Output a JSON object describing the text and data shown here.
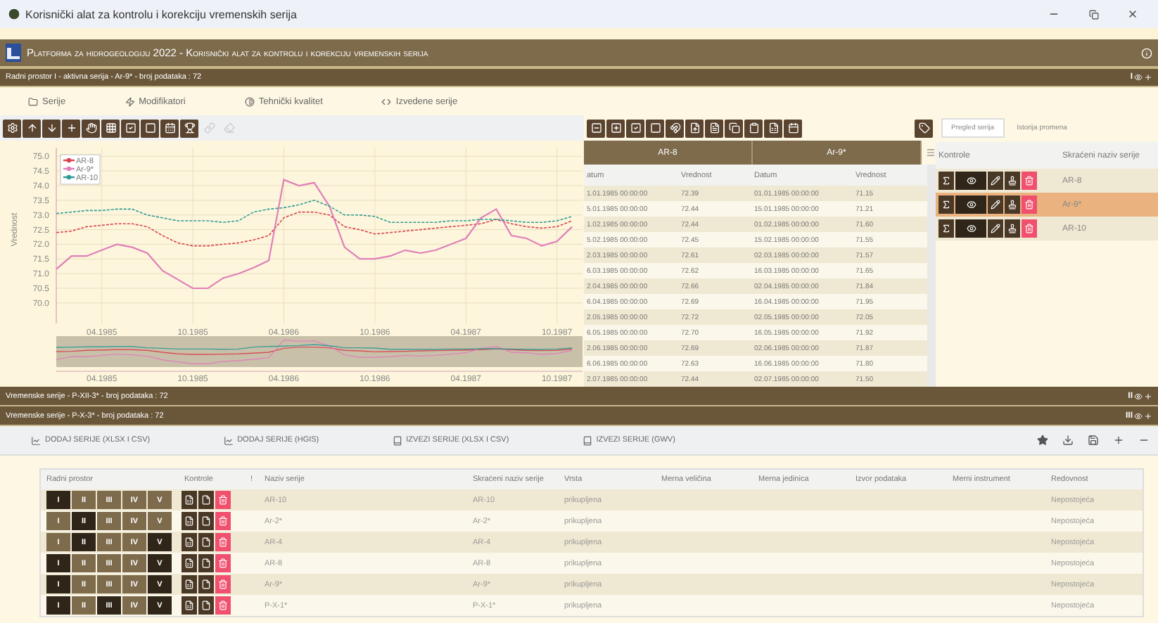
{
  "window": {
    "title": "Korisnički alat za kontrolu i korekciju vremenskih serija"
  },
  "header": {
    "title": "Platforma za hidrogeologiju 2022 - Korisnički alat za kontrolu i korekciju vremenskih serija"
  },
  "workspace_bar": {
    "text": "Radni prostor I - aktivna serija - Ar-9* - broj podataka : 72",
    "badge": "I"
  },
  "tabs": [
    {
      "label": "Serije"
    },
    {
      "label": "Modifikatori"
    },
    {
      "label": "Tehnički kvalitet"
    },
    {
      "label": "Izvedene serije"
    }
  ],
  "chart_toolbar": [
    {
      "disabled": false
    },
    {
      "disabled": false
    },
    {
      "disabled": false
    },
    {
      "disabled": false
    },
    {
      "disabled": false
    },
    {
      "disabled": false
    },
    {
      "disabled": false
    },
    {
      "disabled": false
    },
    {
      "disabled": false
    },
    {
      "disabled": false
    },
    {
      "disabled": true
    },
    {
      "disabled": true
    }
  ],
  "chart": {
    "chart_data": {
      "type": "line",
      "ylabel": "Vrednost",
      "categories": [
        null,
        null,
        null,
        "04.1985",
        null,
        null,
        null,
        null,
        null,
        "10.1985",
        null,
        null,
        null,
        null,
        null,
        "04.1986",
        null,
        null,
        null,
        null,
        null,
        "10.1986",
        null,
        null,
        null,
        null,
        null,
        "04.1987",
        null,
        null,
        null,
        null,
        null,
        "10.1987",
        null
      ],
      "grid": true,
      "legend": true,
      "ylim": [
        69.3,
        75.2
      ],
      "yticks": [
        {
          "value": 70,
          "label": "70.0"
        },
        {
          "value": 70.5,
          "label": "70.5"
        },
        {
          "value": 71,
          "label": "71.0"
        },
        {
          "value": 71.5,
          "label": "71.5"
        },
        {
          "value": 72,
          "label": "72.0"
        },
        {
          "value": 72.5,
          "label": "72.5"
        },
        {
          "value": 73,
          "label": "73.0"
        },
        {
          "value": 73.5,
          "label": "73.5"
        },
        {
          "value": 74,
          "label": "74.0"
        },
        {
          "value": 74.5,
          "label": "74.5"
        },
        {
          "value": 75,
          "label": "75.0"
        }
      ],
      "series": [
        {
          "name": "AR-8",
          "color": "#d9434e",
          "line_style": "dashed",
          "values": [
            72.4,
            72.45,
            72.6,
            72.65,
            72.7,
            72.7,
            72.6,
            72.3,
            72.05,
            71.95,
            71.95,
            72.0,
            72.05,
            72.15,
            72.3,
            72.9,
            73.1,
            73.1,
            73.0,
            72.6,
            72.5,
            72.35,
            72.4,
            72.45,
            72.5,
            72.55,
            72.6,
            72.65,
            72.7,
            72.85,
            72.7,
            72.6,
            72.55,
            72.6,
            72.8
          ]
        },
        {
          "name": "Ar-9*",
          "color": "#e07fb8",
          "line_style": "solid",
          "values": [
            71.15,
            71.6,
            71.6,
            71.8,
            72.0,
            71.9,
            71.7,
            71.1,
            70.8,
            70.5,
            70.5,
            70.85,
            71.0,
            71.2,
            71.45,
            74.2,
            74.0,
            74.1,
            73.3,
            71.9,
            71.5,
            71.5,
            71.6,
            71.8,
            71.7,
            71.8,
            72.0,
            72.2,
            72.9,
            73.2,
            72.3,
            72.2,
            71.95,
            72.1,
            72.6
          ]
        },
        {
          "name": "AR-10",
          "color": "#2f9a94",
          "line_style": "dashed",
          "values": [
            73.05,
            73.1,
            73.15,
            73.15,
            73.2,
            73.2,
            73.0,
            72.9,
            72.8,
            72.8,
            72.8,
            72.75,
            72.8,
            73.1,
            73.2,
            73.25,
            73.35,
            73.5,
            73.3,
            73.0,
            73.0,
            72.95,
            72.75,
            72.75,
            72.75,
            72.75,
            72.8,
            72.8,
            72.85,
            72.85,
            72.8,
            72.75,
            72.75,
            72.8,
            72.95
          ]
        }
      ]
    },
    "navigator_labels": [
      "04.1985",
      "10.1985",
      "04.1986",
      "10.1986",
      "04.1987",
      "10.1987"
    ]
  },
  "data_table": {
    "groups": [
      "AR-8",
      "Ar-9*"
    ],
    "columns": [
      "atum",
      "Vrednost",
      "Datum",
      "Vrednost"
    ],
    "rows": [
      [
        "1.01.1985 00:00:00",
        "72.39",
        "01.01.1985 00:00:00",
        "71.15"
      ],
      [
        "5.01.1985 00:00:00",
        "72.44",
        "15.01.1985 00:00:00",
        "71.21"
      ],
      [
        "1.02.1985 00:00:00",
        "72.44",
        "01.02.1985 00:00:00",
        "71.60"
      ],
      [
        "5.02.1985 00:00:00",
        "72.45",
        "15.02.1985 00:00:00",
        "71.55"
      ],
      [
        "2.03.1985 00:00:00",
        "72.61",
        "02.03.1985 00:00:00",
        "71.57"
      ],
      [
        "6.03.1985 00:00:00",
        "72.62",
        "16.03.1985 00:00:00",
        "71.65"
      ],
      [
        "2.04.1985 00:00:00",
        "72.66",
        "02.04.1985 00:00:00",
        "71.84"
      ],
      [
        "6.04.1985 00:00:00",
        "72.69",
        "16.04.1985 00:00:00",
        "71.95"
      ],
      [
        "2.05.1985 00:00:00",
        "72.72",
        "02.05.1985 00:00:00",
        "72.05"
      ],
      [
        "6.05.1985 00:00:00",
        "72.70",
        "16.05.1985 00:00:00",
        "71.92"
      ],
      [
        "2.06.1985 00:00:00",
        "72.69",
        "02.06.1985 00:00:00",
        "71.87"
      ],
      [
        "6.06.1985 00:00:00",
        "72.63",
        "16.06.1985 00:00:00",
        "71.80"
      ],
      [
        "2.07.1985 00:00:00",
        "72.44",
        "02.07.1985 00:00:00",
        "71.50"
      ]
    ]
  },
  "series_panel": {
    "tabs": [
      {
        "label": "Pregled serija",
        "selected": true
      },
      {
        "label": "Istorija promena",
        "selected": false
      }
    ],
    "columns": [
      "Kontrole",
      "Skraćeni naziv serije"
    ],
    "rows": [
      {
        "name": "AR-8",
        "selected": false
      },
      {
        "name": "Ar-9*",
        "selected": true
      },
      {
        "name": "AR-10",
        "selected": false
      }
    ]
  },
  "series_bars": [
    {
      "text": "Vremenske serije - P-XII-3* - broj podataka : 72",
      "badge": "II"
    },
    {
      "text": "Vremenske serije - P-X-3* - broj podataka : 72",
      "badge": "III"
    }
  ],
  "actions": [
    "DODAJ SERIJE (XLSX I CSV)",
    "DODAJ SERIJE (HGIS)",
    "IZVEZI SERIJE (XLSX I CSV)",
    "IZVEZI SERIJE (GWV)"
  ],
  "series_table": {
    "columns": [
      "Radni prostor",
      "Kontrole",
      "!",
      "Naziv serije",
      "Skraćeni naziv serije",
      "Vrsta",
      "Merna veličina",
      "Merna jedinica",
      "Izvor podataka",
      "Merni instrument",
      "Redovnost"
    ],
    "rows": [
      {
        "workspaces": [
          {
            "label": "I",
            "selected": true
          },
          {
            "label": "II",
            "selected": false
          },
          {
            "label": "III",
            "selected": false
          },
          {
            "label": "IV",
            "selected": false
          },
          {
            "label": "V",
            "selected": false
          }
        ],
        "name": "AR-10",
        "short_name": "AR-10",
        "type": "prikupljena",
        "regularity": "Nepostojeća"
      },
      {
        "workspaces": [
          {
            "label": "I",
            "selected": false
          },
          {
            "label": "II",
            "selected": true
          },
          {
            "label": "III",
            "selected": false
          },
          {
            "label": "IV",
            "selected": false
          },
          {
            "label": "V",
            "selected": false
          }
        ],
        "name": "Ar-2*",
        "short_name": "Ar-2*",
        "type": "prikupljena",
        "regularity": "Nepostojeća"
      },
      {
        "workspaces": [
          {
            "label": "I",
            "selected": false
          },
          {
            "label": "II",
            "selected": true
          },
          {
            "label": "III",
            "selected": false
          },
          {
            "label": "IV",
            "selected": false
          },
          {
            "label": "V",
            "selected": true
          }
        ],
        "name": "AR-4",
        "short_name": "AR-4",
        "type": "prikupljena",
        "regularity": "Nepostojeća"
      },
      {
        "workspaces": [
          {
            "label": "I",
            "selected": true
          },
          {
            "label": "II",
            "selected": false
          },
          {
            "label": "III",
            "selected": false
          },
          {
            "label": "IV",
            "selected": false
          },
          {
            "label": "V",
            "selected": true
          }
        ],
        "name": "AR-8",
        "short_name": "AR-8",
        "type": "prikupljena",
        "regularity": "Nepostojeća"
      },
      {
        "workspaces": [
          {
            "label": "I",
            "selected": true
          },
          {
            "label": "II",
            "selected": false
          },
          {
            "label": "III",
            "selected": false
          },
          {
            "label": "IV",
            "selected": false
          },
          {
            "label": "V",
            "selected": true
          }
        ],
        "name": "Ar-9*",
        "short_name": "Ar-9*",
        "type": "prikupljena",
        "regularity": "Nepostojeća"
      },
      {
        "workspaces": [
          {
            "label": "I",
            "selected": true
          },
          {
            "label": "II",
            "selected": false
          },
          {
            "label": "III",
            "selected": true
          },
          {
            "label": "IV",
            "selected": false
          },
          {
            "label": "V",
            "selected": true
          }
        ],
        "name": "P-X-1*",
        "short_name": "P-X-1*",
        "type": "prikupljena",
        "regularity": "Nepostojeća"
      }
    ]
  }
}
